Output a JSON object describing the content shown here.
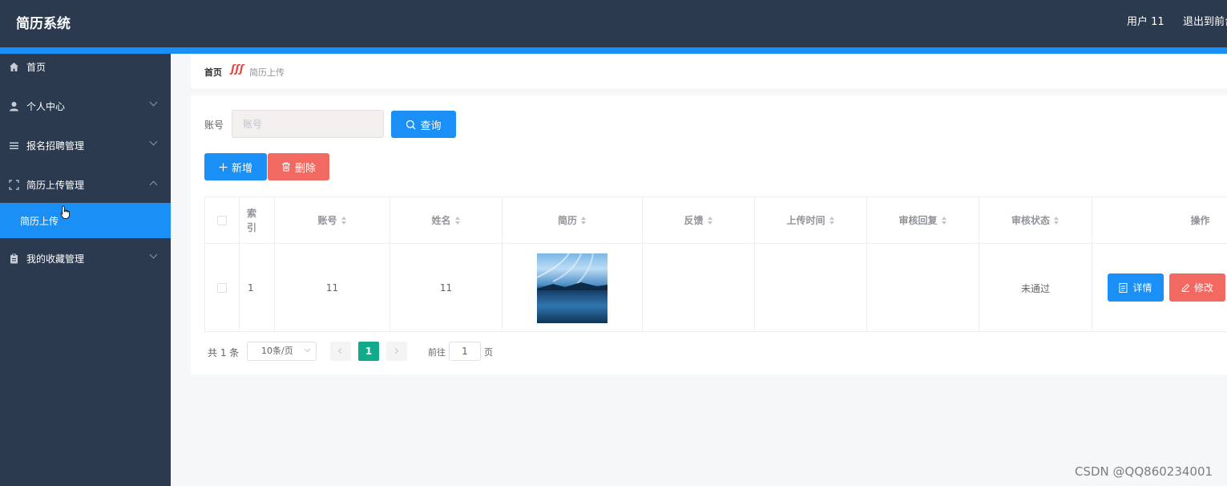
{
  "header": {
    "title": "简历系统",
    "user": "用户 11",
    "exit": "退出到前台"
  },
  "sidebar": {
    "items": [
      {
        "label": "首页",
        "icon": "home-icon"
      },
      {
        "label": "个人中心",
        "icon": "user-icon"
      },
      {
        "label": "报名招聘管理",
        "icon": "list-icon"
      },
      {
        "label": "简历上传管理",
        "icon": "frame-icon",
        "sub": "简历上传"
      },
      {
        "label": "我的收藏管理",
        "icon": "clipboard-icon"
      }
    ]
  },
  "breadcrumb": {
    "home": "首页",
    "separator": "ʃʃʃ",
    "current": "简历上传"
  },
  "search": {
    "label": "账号",
    "placeholder": "账号",
    "query_button": "查询"
  },
  "actions": {
    "add": "新增",
    "delete": "删除"
  },
  "table": {
    "headers": [
      "索引",
      "账号",
      "姓名",
      "简历",
      "反馈",
      "上传时间",
      "审核回复",
      "审核状态",
      "操作"
    ],
    "rows": [
      {
        "index": "1",
        "account": "11",
        "name": "11",
        "feedback": "",
        "upload_time": "",
        "reply": "",
        "status": "未通过"
      }
    ],
    "detail_button": "详情",
    "edit_button": "修改"
  },
  "pagination": {
    "total": "共 1 条",
    "page_size": "10条/页",
    "current_page": "1",
    "goto_label": "前往",
    "goto_value": "1",
    "page_suffix": "页"
  },
  "watermark": "CSDN @QQ860234001",
  "colors": {
    "primary": "#1a8ff5",
    "danger": "#f26961",
    "header_bg": "#2b3a4f",
    "page_active": "#13a98b"
  }
}
